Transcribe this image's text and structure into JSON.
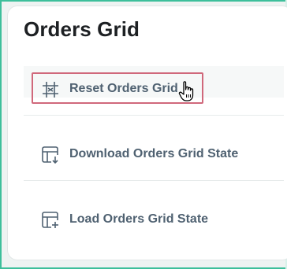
{
  "page": {
    "title": "Orders Grid"
  },
  "menu": {
    "items": [
      {
        "label": "Reset Orders Grid",
        "icon": "grid-reset-icon"
      },
      {
        "label": "Download Orders Grid State",
        "icon": "grid-download-icon"
      },
      {
        "label": "Load Orders Grid State",
        "icon": "grid-load-icon"
      }
    ]
  },
  "colors": {
    "accent": "#3dbf9b",
    "focus": "#d0687b",
    "text": "#4f6171"
  }
}
